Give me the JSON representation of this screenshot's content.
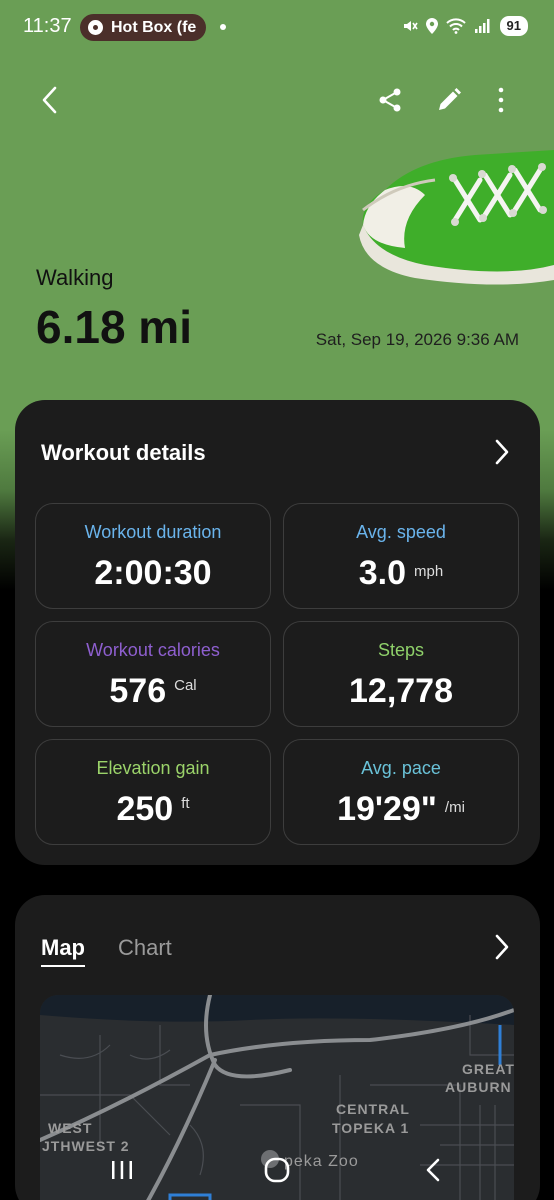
{
  "status_bar": {
    "time": "11:37",
    "media_app": "Hot Box (fe",
    "battery": "91"
  },
  "header": {
    "activity": "Walking",
    "distance": "6.18 mi",
    "datetime": "Sat, Sep 19, 2026 9:36 AM",
    "icons": [
      "back-icon",
      "share-icon",
      "edit-icon",
      "more-icon"
    ]
  },
  "workout_details": {
    "title": "Workout details",
    "tiles": [
      {
        "label": "Workout duration",
        "value": "2:00:30",
        "unit": "",
        "color": "#6ab4ec"
      },
      {
        "label": "Avg. speed",
        "value": "3.0",
        "unit": "mph",
        "color": "#6ab4ec"
      },
      {
        "label": "Workout calories",
        "value": "576",
        "unit": "Cal",
        "color": "#8e5fcf"
      },
      {
        "label": "Steps",
        "value": "12,778",
        "unit": "",
        "color": "#8fd16a"
      },
      {
        "label": "Elevation gain",
        "value": "250",
        "unit": "ft",
        "color": "#9bd36a"
      },
      {
        "label": "Avg. pace",
        "value": "19'29\"",
        "unit": "/mi",
        "color": "#6ac2d8"
      }
    ]
  },
  "map_card": {
    "tabs": [
      "Map",
      "Chart"
    ],
    "active_tab": "Map",
    "map_labels": [
      "WEST",
      "JTHWEST 2",
      "CENTRAL",
      "TOPEKA 1",
      "GREAT",
      "AUBURN",
      "peka Zoo"
    ]
  },
  "colors": {
    "header_bg": "#6a9e55",
    "card_bg": "#1c1c1c"
  }
}
